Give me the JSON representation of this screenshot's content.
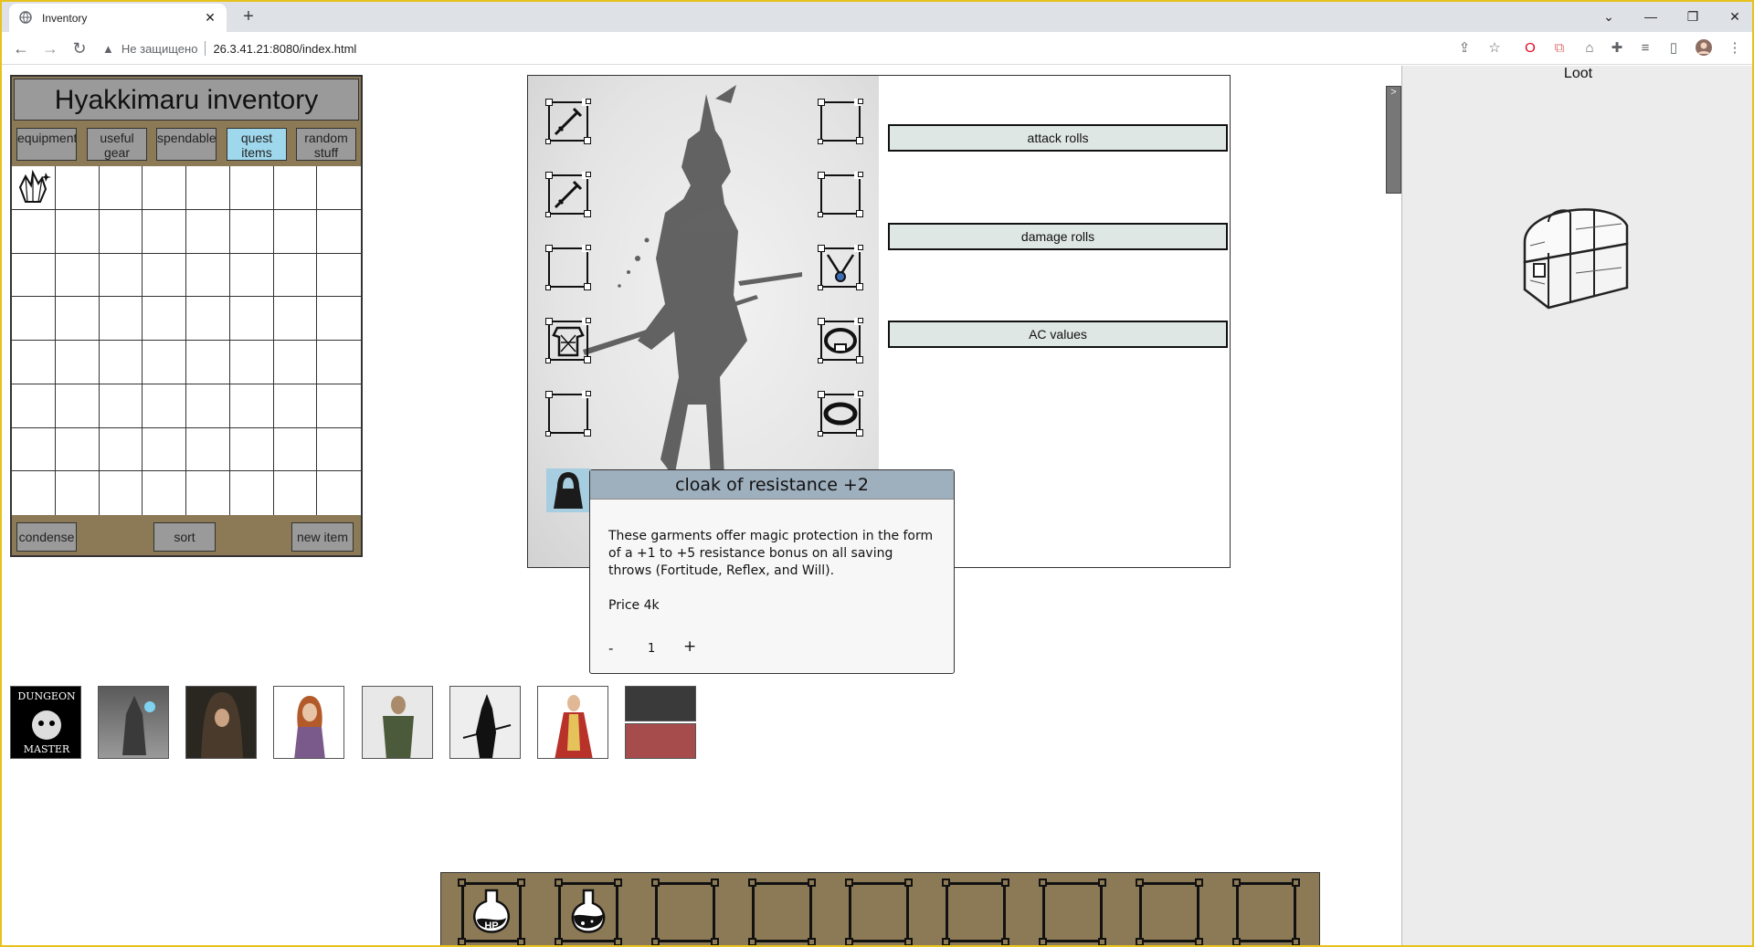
{
  "browser": {
    "tab_title": "Inventory",
    "close_glyph": "✕",
    "newtab_glyph": "+",
    "security_label": "Не защищено",
    "url": "26.3.41.21:8080/index.html",
    "icons": [
      "back-icon",
      "forward-icon",
      "reload-icon",
      "share-icon",
      "star-icon",
      "opera-icon",
      "pdf-icon",
      "extension-off-icon",
      "puzzle-icon",
      "media-icon",
      "sidepanel-icon",
      "profile-icon",
      "menu-icon"
    ]
  },
  "inventory": {
    "title": "Hyakkimaru inventory",
    "categories": [
      {
        "label": "equipment",
        "active": false
      },
      {
        "label": "useful gear",
        "active": false
      },
      {
        "label": "spendable",
        "active": false
      },
      {
        "label": "quest items",
        "active": true
      },
      {
        "label": "random stuff",
        "active": false
      }
    ],
    "grid_rows": 8,
    "grid_cols": 8,
    "items": [
      {
        "name": "crystal-cluster-icon",
        "row": 0,
        "col": 0
      }
    ],
    "buttons": {
      "condense": "condense",
      "sort": "sort",
      "new_item": "new item"
    }
  },
  "character": {
    "stats": [
      "attack rolls",
      "damage rolls",
      "AC values"
    ],
    "left_slots": [
      "sword-icon",
      "sword-icon",
      "empty",
      "chainmail-icon",
      "empty",
      "cloak-icon"
    ],
    "right_slots": [
      "empty",
      "empty",
      "amulet-icon",
      "belt-icon",
      "ring-icon"
    ]
  },
  "tooltip": {
    "title": "cloak of resistance +2",
    "description": "These garments offer magic protection in the form of a +1 to +5 resistance bonus on all saving throws (Fortitude, Reflex, and Will).",
    "price": "Price 4k",
    "minus": "-",
    "quantity": "1",
    "plus": "+"
  },
  "party": {
    "members": [
      "dungeon-master-portrait",
      "mage-portrait",
      "hooded-rogue-portrait",
      "redhead-portrait",
      "barbarian-portrait",
      "samurai-portrait",
      "noblewoman-portrait"
    ],
    "dm_text": [
      "DUNGEON",
      "MASTER"
    ],
    "swatch_colors": [
      "#3a3a3a",
      "#a64c4c"
    ]
  },
  "hotbar": {
    "slots": [
      "hp-potion-icon",
      "dark-potion-icon",
      "empty",
      "empty",
      "empty",
      "empty",
      "empty",
      "empty",
      "empty"
    ],
    "hp_text": "HP"
  },
  "loot": {
    "title": "Loot",
    "toggle": ">",
    "chest": "treasure-chest-icon"
  }
}
